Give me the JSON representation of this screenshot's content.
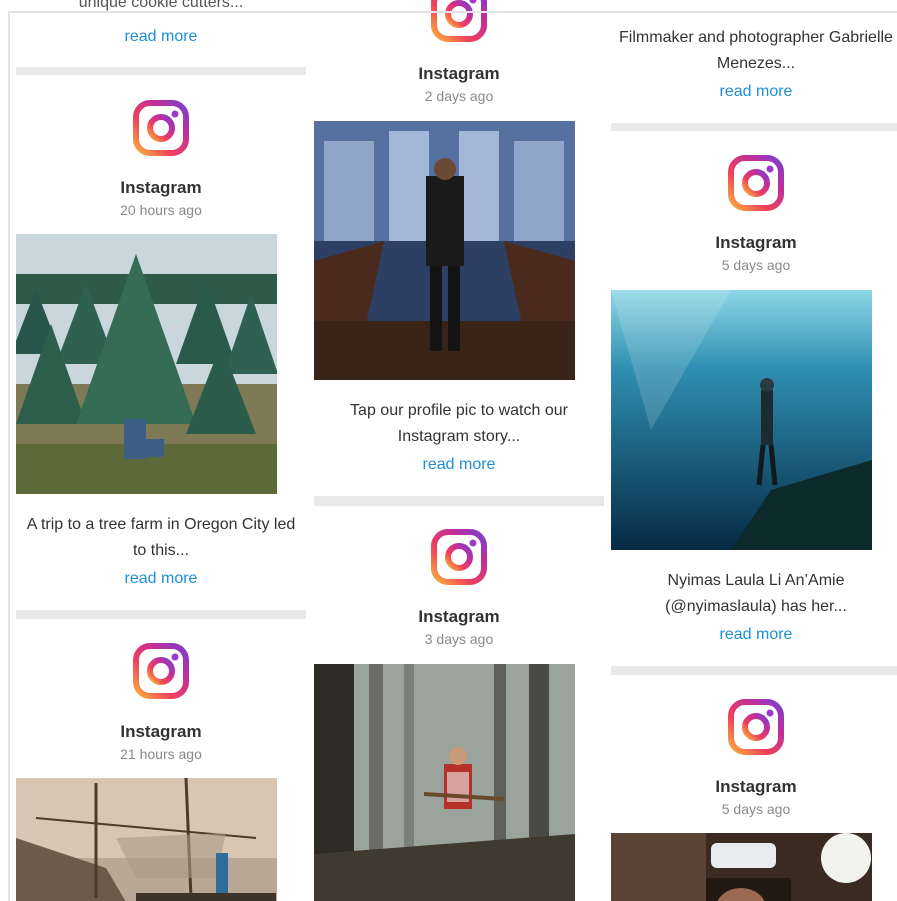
{
  "columns": [
    {
      "cards": [
        {
          "caption": "unique cookie cutters...",
          "read_more": "read more"
        },
        {
          "source": "Instagram",
          "time": "20 hours ago",
          "photo": "christmas-tree-farm-photo",
          "caption": "A trip to a tree farm in Oregon City led to this...",
          "read_more": "read more"
        },
        {
          "source": "Instagram",
          "time": "21 hours ago",
          "photo": "fishing-nets-river-photo"
        }
      ]
    },
    {
      "cards": [
        {
          "source": "Instagram",
          "time": "2 days ago",
          "photo": "cathedral-musician-photo",
          "caption": "Tap our profile pic to watch our Instagram story...",
          "read_more": "read more"
        },
        {
          "source": "Instagram",
          "time": "3 days ago",
          "photo": "flying-broom-forest-photo"
        }
      ]
    },
    {
      "cards": [
        {
          "caption": "Filmmaker and photographer Gabrielle Menezes...",
          "read_more": "read more"
        },
        {
          "source": "Instagram",
          "time": "5 days ago",
          "photo": "underwater-freediver-photo",
          "caption": "Nyimas Laula Li An’Amie (@nyimaslaula) has her...",
          "read_more": "read more"
        },
        {
          "source": "Instagram",
          "time": "5 days ago",
          "photo": "portrait-lamp-photo"
        }
      ]
    }
  ],
  "colors": {
    "link": "#1e8fd6",
    "gutter": "#e9e9e9",
    "text": "#333333",
    "muted": "#8a8a8a"
  },
  "icons": {
    "logo": "instagram-logo-icon"
  }
}
